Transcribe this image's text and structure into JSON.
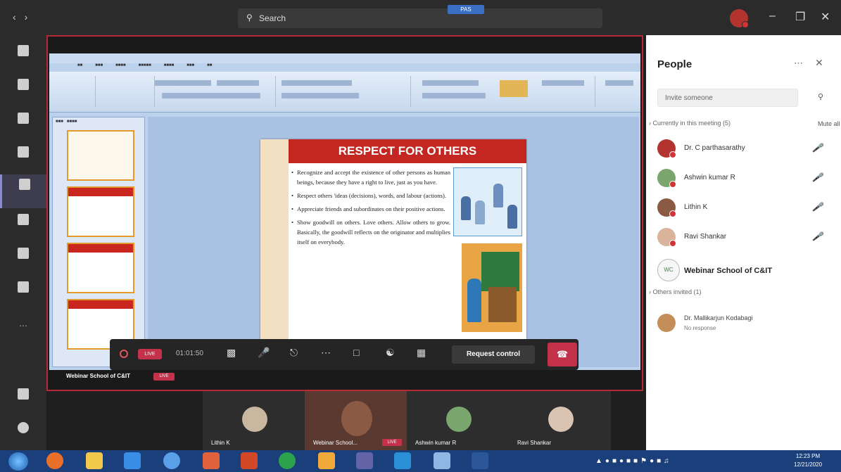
{
  "titlebar": {
    "search_placeholder": "Search",
    "pill_label": "PAS"
  },
  "presentation": {
    "slide_title": "RESPECT FOR OTHERS",
    "bullets": [
      "Recognize and accept the existence of other persons as human beings, because they have a right to live, just as you have.",
      "Respect others 'ideas (decisions), words, and labour (actions).",
      "Appreciate friends and subordinates on their positive actions.",
      "Show goodwill on others. Love others. Allow others to grow. Basically, the goodwill reflects on the originator and multiplies itself on everybody."
    ]
  },
  "stage_label": {
    "name": "Webinar School of C&IT",
    "live": "LIVE"
  },
  "call_controls": {
    "live": "LIVE",
    "timer": "01:01:50",
    "request_control": "Request control"
  },
  "video_strip": [
    {
      "name": "Lithin K",
      "live": ""
    },
    {
      "name": "Webinar School...",
      "live": "LIVE"
    },
    {
      "name": "Ashwin kumar R",
      "live": ""
    },
    {
      "name": "Ravi Shankar",
      "live": ""
    }
  ],
  "people_panel": {
    "title": "People",
    "invite_placeholder": "Invite someone",
    "current_section": "Currently in this meeting (5)",
    "mute_all": "Mute all",
    "participants": [
      {
        "name": "Dr. C parthasarathy"
      },
      {
        "name": "Ashwin kumar R"
      },
      {
        "name": "Lithin K"
      },
      {
        "name": "Ravi Shankar"
      }
    ],
    "organizer": {
      "initials": "WC",
      "name": "Webinar School of C&IT"
    },
    "invited_section": "Others invited (1)",
    "invited": {
      "name": "Dr. Mallikarjun Kodabagi",
      "status": "No response"
    }
  },
  "taskbar": {
    "time": "12:23 PM",
    "date": "12/21/2020"
  }
}
